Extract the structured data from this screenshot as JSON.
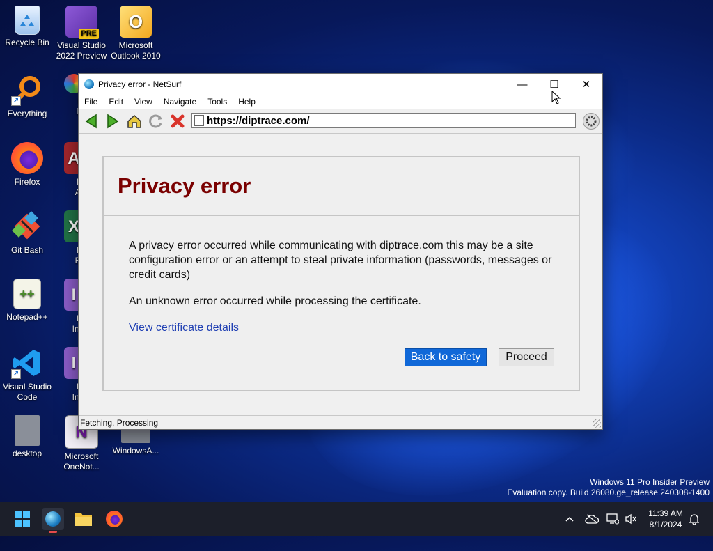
{
  "desktop": {
    "icons": [
      {
        "label": "Recycle Bin"
      },
      {
        "label": "Visual Studio 2022 Preview",
        "badge": "PRE"
      },
      {
        "label": "Microsoft Outlook 2010"
      },
      {
        "label": "Everything"
      },
      {
        "label": "Inte... Dow..."
      },
      {
        "label": "Firefox"
      },
      {
        "label": "Micr... Acce..."
      },
      {
        "label": "Git Bash"
      },
      {
        "label": "Micr... Exce..."
      },
      {
        "label": "Notepad++"
      },
      {
        "label": "Micr... InfoPa..."
      },
      {
        "label": "Visual Studio Code"
      },
      {
        "label": "Micr... InfoPa..."
      },
      {
        "label": "desktop"
      },
      {
        "label": "Microsoft OneNot..."
      },
      {
        "label": "WindowsA..."
      }
    ]
  },
  "window": {
    "title": "Privacy error  -  NetSurf",
    "controls": {
      "minimize": "—",
      "maximize": "☐",
      "close": "✕"
    },
    "menu": [
      "File",
      "Edit",
      "View",
      "Navigate",
      "Tools",
      "Help"
    ],
    "url": "https://diptrace.com/",
    "status": "Fetching, Processing"
  },
  "page": {
    "heading": "Privacy error",
    "message": "A privacy error occurred while communicating with diptrace.com this may be a site configuration error or an attempt to steal private information (passwords, messages or credit cards)",
    "detail": "An unknown error occurred while processing the certificate.",
    "link": "View certificate details",
    "buttons": {
      "safety": "Back to safety",
      "proceed": "Proceed"
    }
  },
  "watermark": {
    "line1": "Windows 11 Pro Insider Preview",
    "line2": "Evaluation copy. Build 26080.ge_release.240308-1400"
  },
  "taskbar": {
    "time": "11:39 AM",
    "date": "8/1/2024"
  },
  "colors": {
    "heading": "#7a0000",
    "primary_button": "#1068d8",
    "link": "#1f3fb3"
  }
}
